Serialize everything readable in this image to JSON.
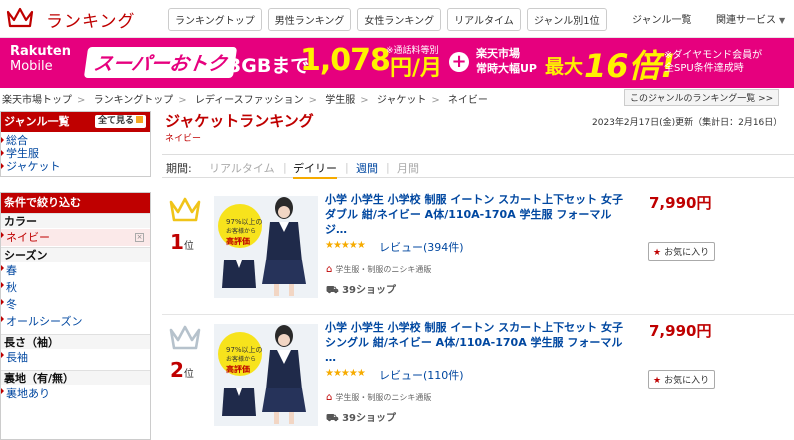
{
  "header": {
    "brand": "ランキング",
    "nav": [
      "ランキングトップ",
      "男性ランキング",
      "女性ランキング",
      "リアルタイム",
      "ジャンル別1位"
    ],
    "genre_list": "ジャンル一覧",
    "related": "関連サービス"
  },
  "banner": {
    "rakuten": "Rakuten",
    "mobile": "Mobile",
    "super": "スーパーおトク",
    "gb": "3GBまで",
    "price": "1,078",
    "note": "※通話料等別",
    "unit": "円/月",
    "plus": "+",
    "ichiba_1": "楽天市場",
    "ichiba_2": "常時大幅UP",
    "max": "最大",
    "bai": "16倍!",
    "dia_1": "※ダイヤモンド会員が",
    "dia_2": "全SPU条件達成時"
  },
  "breadcrumb": {
    "items": [
      "楽天市場トップ",
      "ランキングトップ",
      "レディースファッション",
      "学生服",
      "ジャケット",
      "ネイビー"
    ],
    "more": "このジャンルのランキング一覧 >>"
  },
  "sidebar": {
    "genre_head": "ジャンル一覧",
    "show_all": "全て見る",
    "genres": [
      "総合",
      "学生服",
      "ジャケット"
    ],
    "filter_head": "条件で絞り込む",
    "sections": [
      {
        "title": "カラー",
        "items": [
          "ネイビー"
        ]
      },
      {
        "title": "シーズン",
        "items": [
          "春",
          "秋",
          "冬",
          "オールシーズン"
        ]
      },
      {
        "title": "長さ（袖）",
        "items": [
          "長袖"
        ]
      },
      {
        "title": "裏地（有/無）",
        "items": [
          "裏地あり"
        ]
      }
    ]
  },
  "main": {
    "title": "ジャケットランキング",
    "subtitle": "ネイビー",
    "updated": "2023年2月17日(金)更新（集計日：2月16日）",
    "period_label": "期間:",
    "periods": [
      "リアルタイム",
      "デイリー",
      "週間",
      "月間"
    ]
  },
  "items": [
    {
      "rank": "1",
      "rank_suffix": "位",
      "name": "小学 小学生 小学校 制服 イートン スカート上下セット 女子 ダブル 紺/ネイビー A体/110A-170A 学生服 フォーマル ジ…",
      "stars": "★★★★★",
      "review": "レビュー(394件)",
      "shop_note": "学生服・制服のニシキ通販",
      "shop": "39ショップ",
      "price": "7,990円",
      "fav": "お気に入り",
      "badge_1": "97%以上の",
      "badge_2": "お客様から",
      "badge_3": "高評価"
    },
    {
      "rank": "2",
      "rank_suffix": "位",
      "name": "小学 小学生 小学校 制服 イートン スカート上下セット 女子 シングル 紺/ネイビー A体/110A-170A 学生服 フォーマル …",
      "stars": "★★★★★",
      "review": "レビュー(110件)",
      "shop_note": "学生服・制服のニシキ通販",
      "shop": "39ショップ",
      "price": "7,990円",
      "fav": "お気に入り",
      "badge_1": "97%以上の",
      "badge_2": "お客様から",
      "badge_3": "高評価"
    }
  ]
}
